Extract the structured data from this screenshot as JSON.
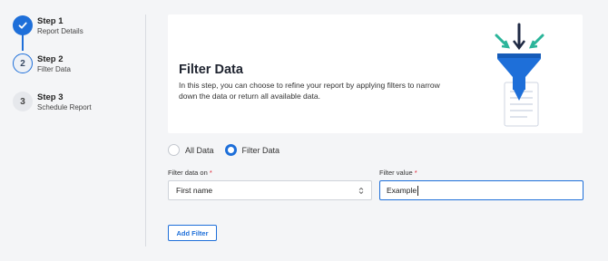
{
  "steps": [
    {
      "number": "1",
      "title": "Step 1",
      "subtitle": "Report Details",
      "status": "done"
    },
    {
      "number": "2",
      "title": "Step 2",
      "subtitle": "Filter Data",
      "status": "active"
    },
    {
      "number": "3",
      "title": "Step 3",
      "subtitle": "Schedule Report",
      "status": "todo"
    }
  ],
  "hero": {
    "title": "Filter Data",
    "description": "In this step, you can choose to refine your report by applying filters to narrow down the data or return all available data.",
    "illustration_icon": "funnel-icon"
  },
  "radio": {
    "options": [
      {
        "label": "All Data",
        "checked": false
      },
      {
        "label": "Filter Data",
        "checked": true
      }
    ]
  },
  "filter_on": {
    "label": "Filter data on",
    "required_mark": "*",
    "value": "First name"
  },
  "filter_value": {
    "label": "Filter value",
    "required_mark": "*",
    "value": "Example"
  },
  "add_filter_label": "Add Filter",
  "colors": {
    "accent": "#1e6fd9",
    "required": "#dd2233",
    "background": "#f4f5f7"
  }
}
